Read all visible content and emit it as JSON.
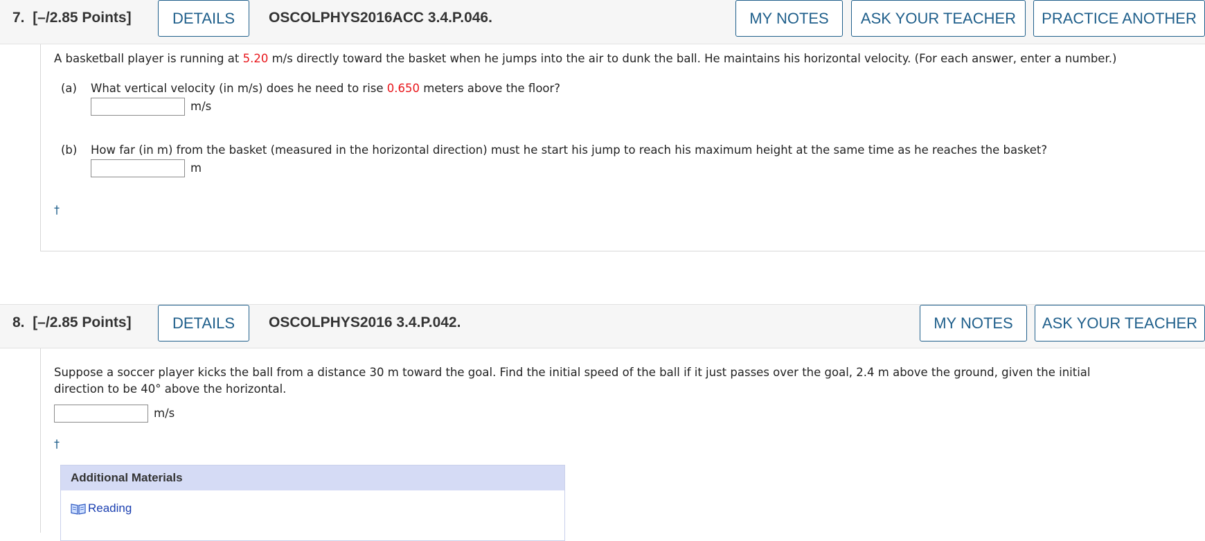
{
  "q7": {
    "number": "7.",
    "points": "[–/2.85 Points]",
    "details_label": "DETAILS",
    "code": "OSCOLPHYS2016ACC 3.4.P.046.",
    "my_notes_label": "MY NOTES",
    "ask_teacher_label": "ASK YOUR TEACHER",
    "practice_label": "PRACTICE ANOTHER",
    "intro_pre": "A basketball player is running at ",
    "speed": "5.20",
    "intro_post": " m/s directly toward the basket when he jumps into the air to dunk the ball. He maintains his horizontal velocity. (For each answer, enter a number.)",
    "a_label": "(a)",
    "a_pre": "What vertical velocity (in m/s) does he need to rise ",
    "a_height": "0.650",
    "a_post": " meters above the floor?",
    "a_unit": "m/s",
    "a_value": "",
    "b_label": "(b)",
    "b_text": "How far (in m) from the basket (measured in the horizontal direction) must he start his jump to reach his maximum height at the same time as he reaches the basket?",
    "b_unit": "m",
    "b_value": "",
    "dagger": "†"
  },
  "q8": {
    "number": "8.",
    "points": "[–/2.85 Points]",
    "details_label": "DETAILS",
    "code": "OSCOLPHYS2016 3.4.P.042.",
    "my_notes_label": "MY NOTES",
    "ask_teacher_label": "ASK YOUR TEACHER",
    "text_line1": "Suppose a soccer player kicks the ball from a distance 30 m toward the goal. Find the initial speed of the ball if it just passes over the goal, 2.4 m above the ground, given the initial",
    "text_line2": "direction to be 40° above the horizontal.",
    "unit": "m/s",
    "value": "",
    "dagger": "†",
    "additional_materials": {
      "heading": "Additional Materials",
      "reading_label": "Reading",
      "reading_icon": "book-icon"
    }
  },
  "colors": {
    "accent": "#1f5f8b",
    "highlight": "#e8161b",
    "header_bg": "#f6f6f6",
    "materials_header_bg": "#d5dbf5",
    "link": "#1a3fb0"
  }
}
